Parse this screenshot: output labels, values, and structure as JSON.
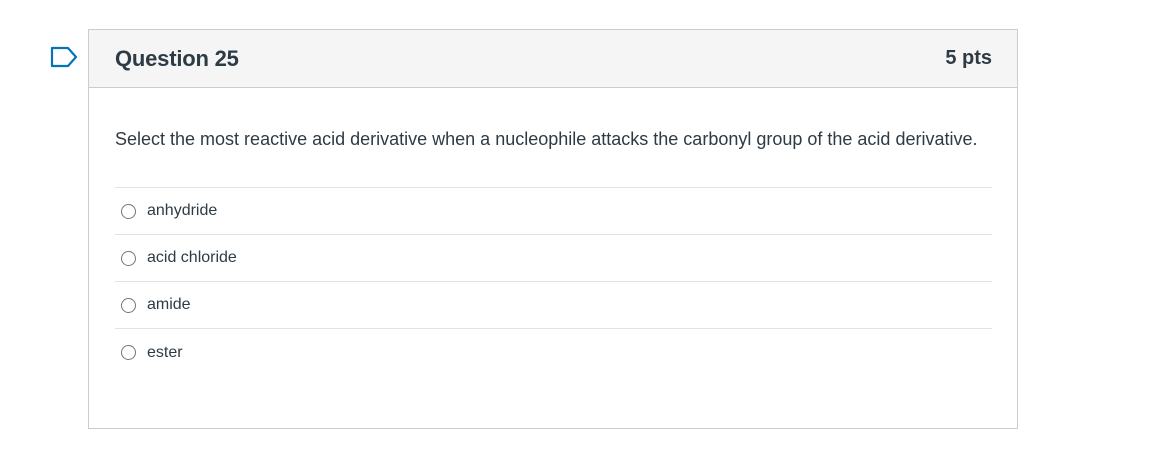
{
  "question": {
    "title": "Question 25",
    "points": "5 pts",
    "text": "Select the most reactive acid derivative when a nucleophile attacks the carbonyl group of the acid derivative.",
    "flag_icon": "flag-question-icon",
    "accent_color": "#0374b5",
    "answers": [
      {
        "label": "anhydride"
      },
      {
        "label": "acid chloride"
      },
      {
        "label": "amide"
      },
      {
        "label": "ester"
      }
    ]
  }
}
